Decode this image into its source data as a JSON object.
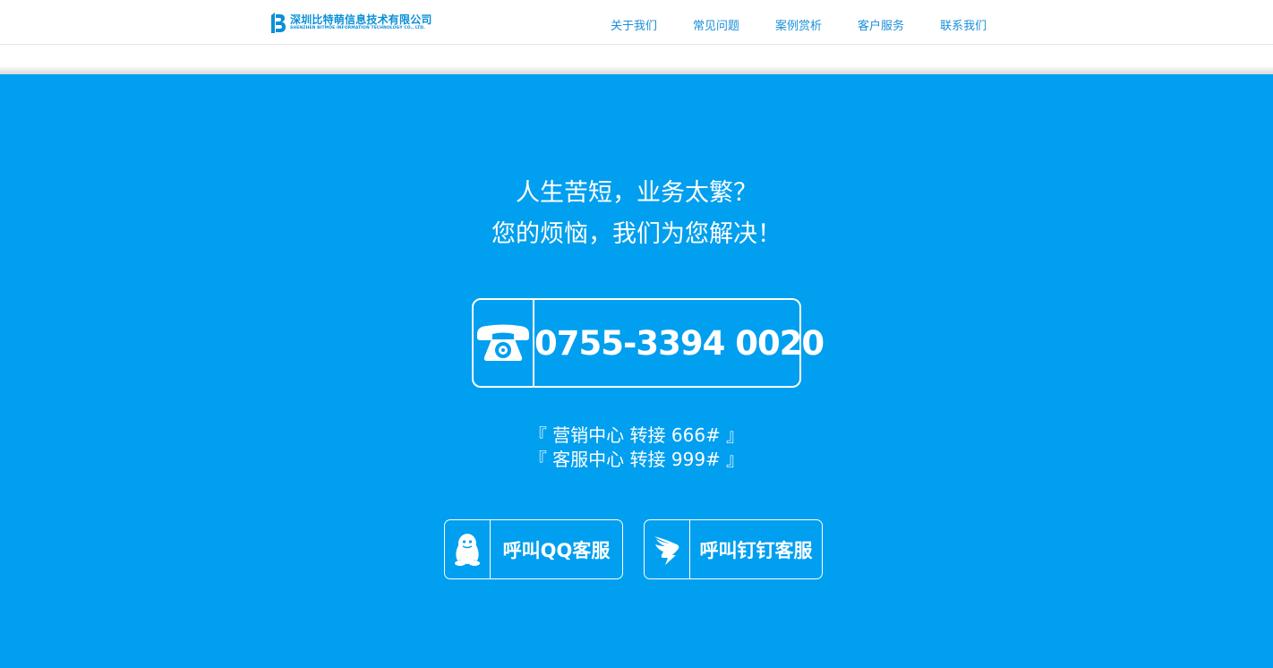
{
  "header": {
    "logo": {
      "name_cn": "深圳比特萌信息技术有限公司",
      "name_en": "SHENZHEN BITMOE INFORMATION TECHNOLOGY CO., LTD."
    },
    "nav": [
      {
        "label": "关于我们"
      },
      {
        "label": "常见问题"
      },
      {
        "label": "案例赏析"
      },
      {
        "label": "客户服务"
      },
      {
        "label": "联系我们"
      }
    ]
  },
  "main": {
    "slogan_line1": "人生苦短，业务太繁？",
    "slogan_line2": "您的烦恼，我们为您解决！",
    "phone": "0755-3394 0020",
    "ext_marketing": "『 营销中心 转接 666# 』",
    "ext_service": "『 客服中心 转接 999# 』",
    "qq_button": "呼叫QQ客服",
    "dingtalk_button": "呼叫钉钉客服"
  },
  "colors": {
    "brand_blue": "#009fef",
    "nav_text": "#1a8fd8",
    "white": "#ffffff"
  },
  "icons": {
    "logo": "logo-b-icon",
    "phone": "telephone-icon",
    "qq": "qq-penguin-icon",
    "dingtalk": "dingtalk-icon"
  }
}
